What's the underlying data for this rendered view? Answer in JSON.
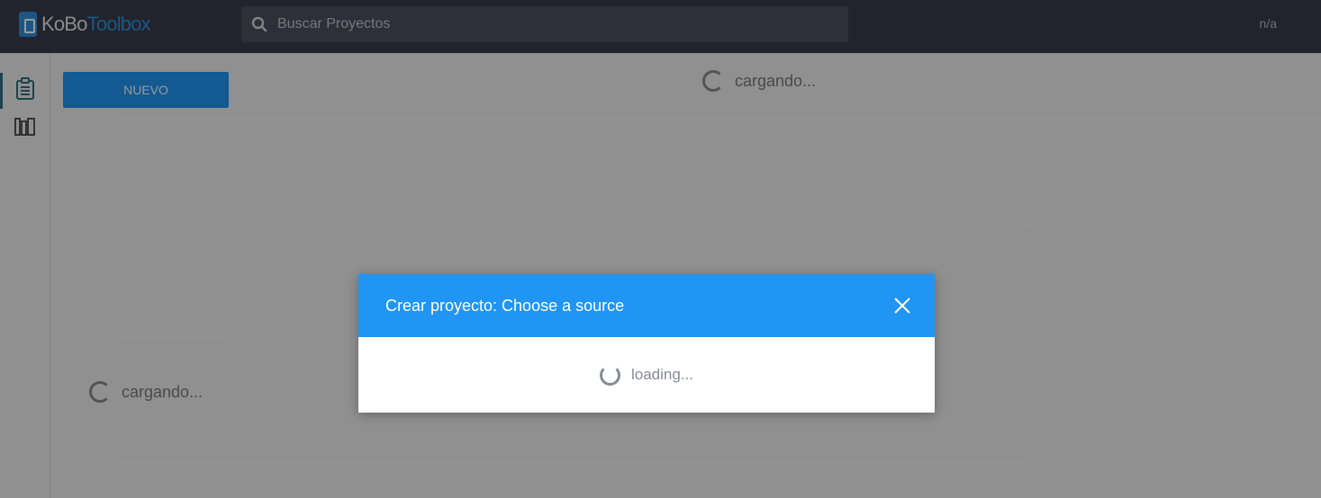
{
  "header": {
    "logo_part1": "KoBo",
    "logo_part2": "Toolbox",
    "search_placeholder": "Buscar Proyectos",
    "account_label": "n/a"
  },
  "sidebar": {
    "items": [
      {
        "name": "projects",
        "icon": "clipboard-icon",
        "active": true
      },
      {
        "name": "library",
        "icon": "library-icon",
        "active": false
      }
    ]
  },
  "main": {
    "new_button_label": "NUEVO",
    "loading_text_top": "cargando...",
    "loading_text_left": "cargando..."
  },
  "modal": {
    "title": "Crear proyecto: Choose a source",
    "loading_text": "loading..."
  },
  "colors": {
    "header_bg": "#3a3d4c",
    "accent_blue": "#2095f3",
    "logo_blue": "#2f8fd8",
    "sidebar_active": "#2e6f87"
  }
}
